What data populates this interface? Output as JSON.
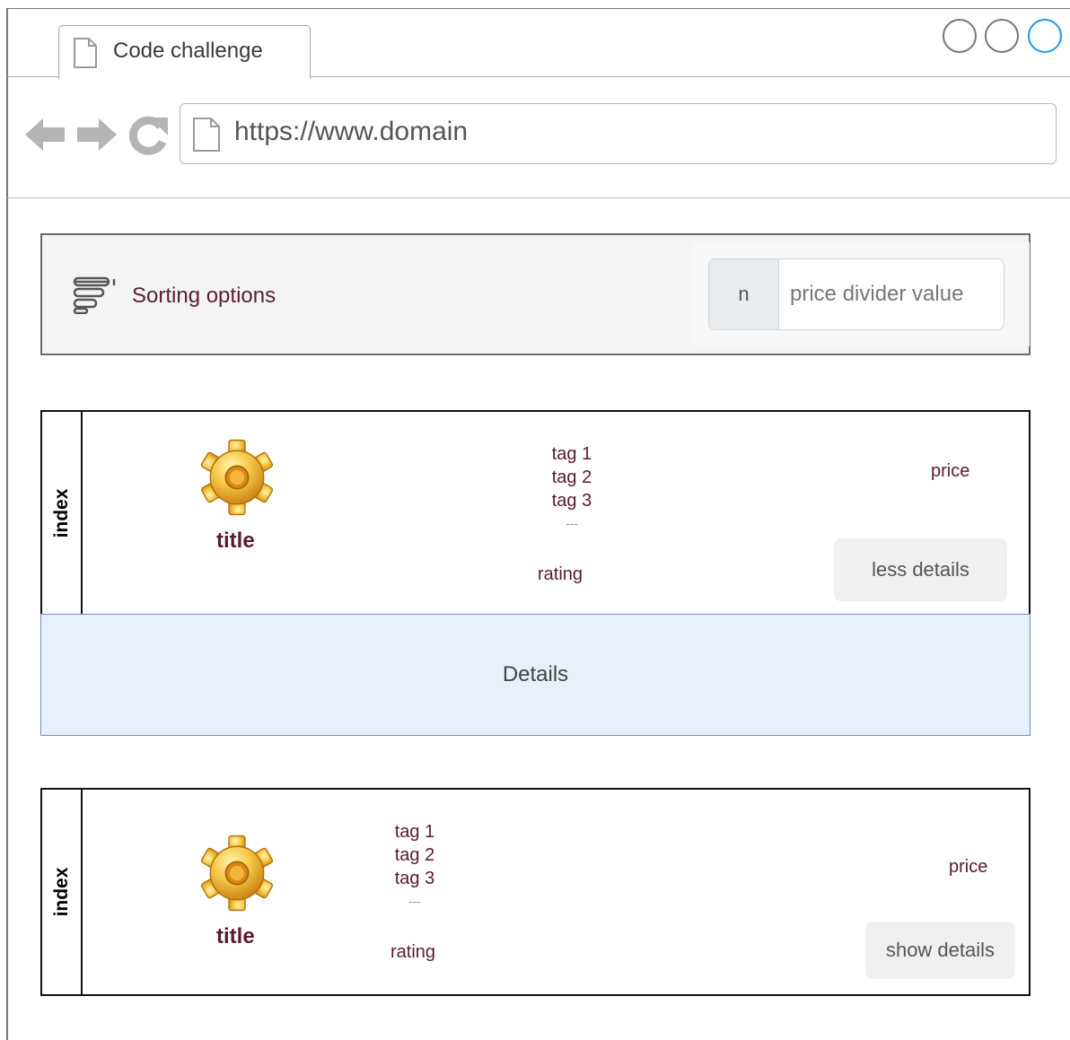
{
  "browser": {
    "tab_title": "Code challenge",
    "url": "https://www.domain"
  },
  "sorting": {
    "label": "Sorting options",
    "input_prefix": "n",
    "input_placeholder": "price divider value"
  },
  "items": [
    {
      "index": "index",
      "title": "title",
      "tags": [
        "tag 1",
        "tag 2",
        "tag 3"
      ],
      "tags_more": "---",
      "rating": "rating",
      "price": "price",
      "toggle_label": "less details",
      "expanded": true,
      "details": "Details"
    },
    {
      "index": "index",
      "title": "title",
      "tags": [
        "tag 1",
        "tag 2",
        "tag 3"
      ],
      "tags_more": "---",
      "rating": "rating",
      "price": "price",
      "toggle_label": "show details",
      "expanded": false
    }
  ],
  "icons": {
    "nav_back": "arrow-left-icon",
    "nav_forward": "arrow-right-icon",
    "reload": "reload-icon",
    "page": "document-icon",
    "sort": "sort-lines-icon",
    "item": "gear-icon"
  },
  "colors": {
    "text_accent": "#5b1a2e",
    "details_bg": "#e8f1fb",
    "details_border": "#6c8ebf",
    "window_button_active": "#2196f3"
  }
}
